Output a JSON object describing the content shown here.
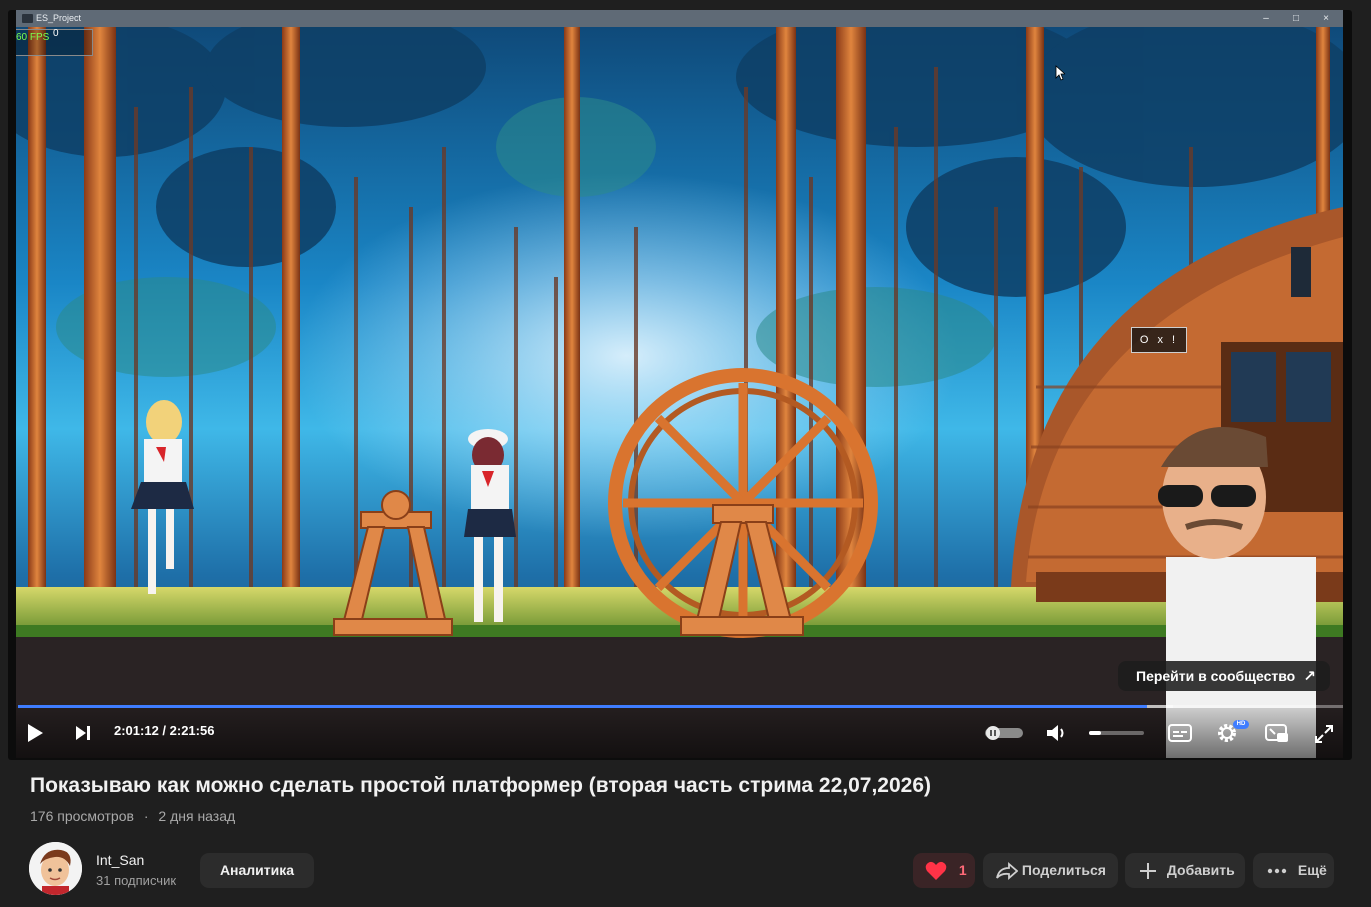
{
  "window": {
    "title": "ES_Project",
    "minimize_glyph": "–",
    "maximize_glyph": "□",
    "close_glyph": "×"
  },
  "game": {
    "fps_label": "60 FPS",
    "fps_counter": "0",
    "sign_text": "O x !"
  },
  "player": {
    "community_label": "Перейти в сообщество",
    "time_display": "2:01:12 / 2:21:56",
    "played_fraction": 0.852,
    "buffered_fraction": 0.872,
    "volume_fraction": 0.22,
    "hd_badge": "HD",
    "accent_color": "#3f7dff"
  },
  "video": {
    "title": "Показываю как можно сделать простой платформер (вторая часть стрима 22,07,2026)",
    "views": "176 просмотров",
    "separator": "·",
    "age": "2 дня назад"
  },
  "channel": {
    "name": "Int_San",
    "subscribers": "31 подписчик"
  },
  "actions": {
    "analytics_label": "Аналитика",
    "like_count": "1",
    "share_label": "Поделиться",
    "add_label": "Добавить",
    "more_label": "Ещё"
  },
  "icons": [
    "play-icon",
    "next-icon",
    "autoplay-toggle-icon",
    "volume-icon",
    "subtitles-icon",
    "settings-icon",
    "miniplayer-icon",
    "fullscreen-icon",
    "heart-icon",
    "share-icon",
    "plus-icon",
    "more-dots-icon",
    "external-arrow-icon"
  ]
}
